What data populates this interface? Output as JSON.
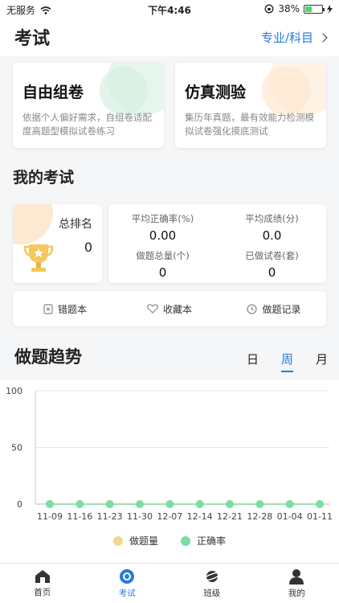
{
  "status_bar": {
    "carrier": "无服务",
    "time": "下午4:46",
    "battery": "38%",
    "battery_level": 0.38
  },
  "header": {
    "title": "考试",
    "major_link": "专业/科目"
  },
  "modes": [
    {
      "title": "自由组卷",
      "desc": "依据个人偏好需求，自组卷适配度高题型模拟试卷练习",
      "accent": "#d9f1e4"
    },
    {
      "title": "仿真测验",
      "desc": "集历年真题，最有效能力检测模拟试卷强化摸底测试",
      "accent": "#fdeedd"
    }
  ],
  "my_exams": {
    "title": "我的考试",
    "rank_label": "总排名",
    "rank_value": "0",
    "stats": [
      {
        "label": "平均正确率(%)",
        "value": "0.00"
      },
      {
        "label": "平均成绩(分)",
        "value": "0.0"
      },
      {
        "label": "做题总量(个)",
        "value": "0"
      },
      {
        "label": "已做试卷(套)",
        "value": "0"
      }
    ]
  },
  "actions": [
    {
      "label": "错题本",
      "icon": "wrong-book-icon"
    },
    {
      "label": "收藏本",
      "icon": "heart-icon"
    },
    {
      "label": "做题记录",
      "icon": "clock-icon"
    }
  ],
  "trend": {
    "title": "做题趋势",
    "tabs": [
      {
        "label": "日",
        "active": false
      },
      {
        "label": "周",
        "active": true
      },
      {
        "label": "月",
        "active": false
      }
    ]
  },
  "chart_data": {
    "type": "line",
    "categories": [
      "11-09",
      "11-16",
      "11-23",
      "11-30",
      "12-07",
      "12-14",
      "12-21",
      "12-28",
      "01-04",
      "01-11"
    ],
    "yticks": [
      0,
      50,
      100
    ],
    "ylim": [
      0,
      100
    ],
    "series": [
      {
        "name": "做题量",
        "color": "#f2d98a",
        "values": [
          0,
          0,
          0,
          0,
          0,
          0,
          0,
          0,
          0,
          0
        ]
      },
      {
        "name": "正确率",
        "color": "#7ddca3",
        "values": [
          0,
          0,
          0,
          0,
          0,
          0,
          0,
          0,
          0,
          0
        ]
      }
    ],
    "grid": true,
    "legend": "bottom"
  },
  "tabbar": [
    {
      "label": "首页",
      "icon": "home-icon",
      "active": false
    },
    {
      "label": "考试",
      "icon": "exam-icon",
      "active": true
    },
    {
      "label": "班级",
      "icon": "planet-icon",
      "active": false
    },
    {
      "label": "我的",
      "icon": "user-icon",
      "active": false
    }
  ]
}
